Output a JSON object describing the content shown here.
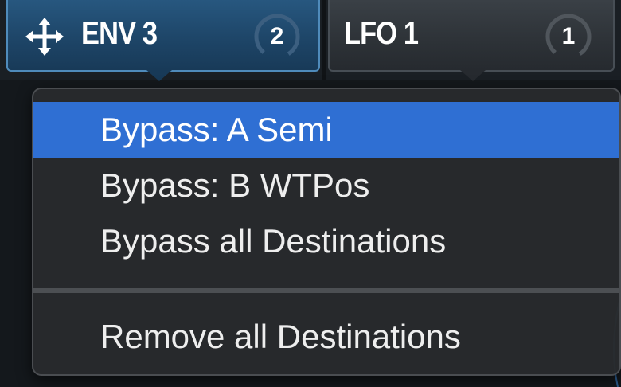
{
  "tabs": [
    {
      "label": "ENV 3",
      "count": "2",
      "active": true
    },
    {
      "label": "LFO 1",
      "count": "1",
      "active": false
    }
  ],
  "menu": {
    "items": [
      {
        "label": "Bypass: A Semi",
        "selected": true
      },
      {
        "label": "Bypass: B WTPos",
        "selected": false
      },
      {
        "label": "Bypass all Destinations",
        "selected": false
      }
    ],
    "footer_items": [
      {
        "label": "Remove all Destinations",
        "selected": false
      }
    ]
  },
  "colors": {
    "active_tab": "#1d4466",
    "inactive_tab": "#2d3237",
    "menu_highlight": "#2f6fd3",
    "menu_bg": "#28292d"
  }
}
